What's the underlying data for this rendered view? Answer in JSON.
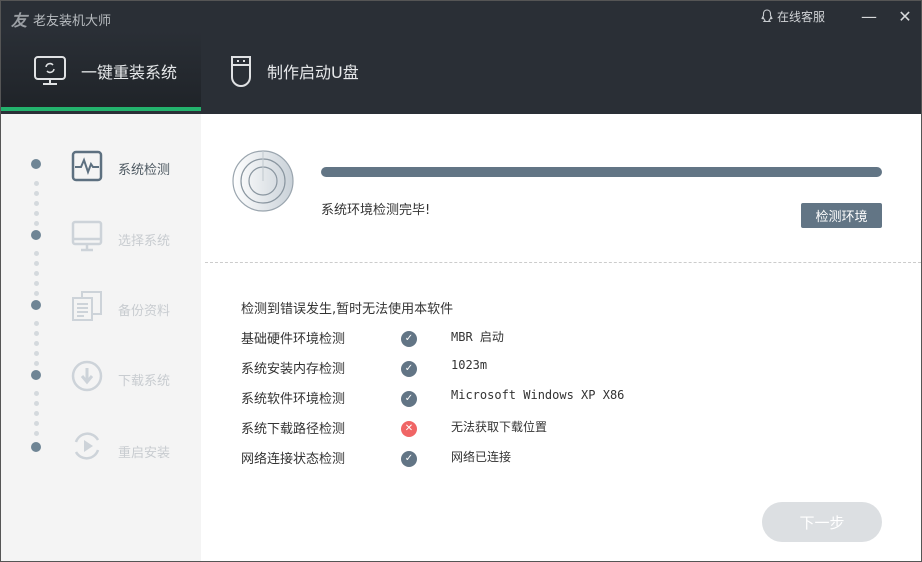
{
  "app": {
    "logo_glyph": "友",
    "title": "老友装机大师",
    "support": "在线客服",
    "minimize": "—",
    "close": "✕"
  },
  "tabs": [
    {
      "label": "一键重装系统",
      "icon": "monitor-refresh-icon",
      "active": true
    },
    {
      "label": "制作启动U盘",
      "icon": "usb-drive-icon",
      "active": false
    }
  ],
  "steps": [
    {
      "label": "系统检测",
      "icon": "pulse-monitor-icon",
      "active": true
    },
    {
      "label": "选择系统",
      "icon": "monitor-icon",
      "active": false
    },
    {
      "label": "备份资料",
      "icon": "documents-icon",
      "active": false
    },
    {
      "label": "下载系统",
      "icon": "download-icon",
      "active": false
    },
    {
      "label": "重启安装",
      "icon": "restart-play-icon",
      "active": false
    }
  ],
  "detect": {
    "progress_percent": 100,
    "status": "系统环境检测完毕!",
    "button": "检测环境"
  },
  "error_message": "检测到错误发生,暂时无法使用本软件",
  "checks": [
    {
      "name": "基础硬件环境检测",
      "ok": true,
      "value": "MBR 启动"
    },
    {
      "name": "系统安装内存检测",
      "ok": true,
      "value": "1023m"
    },
    {
      "name": "系统软件环境检测",
      "ok": true,
      "value": "Microsoft Windows XP X86"
    },
    {
      "name": "系统下载路径检测",
      "ok": false,
      "value": "无法获取下载位置"
    },
    {
      "name": "网络连接状态检测",
      "ok": true,
      "value": "网络已连接"
    }
  ],
  "next_button": "下一步",
  "colors": {
    "accent": "#23b26d",
    "slate": "#627585",
    "ok": "#627585",
    "error": "#f06565"
  }
}
